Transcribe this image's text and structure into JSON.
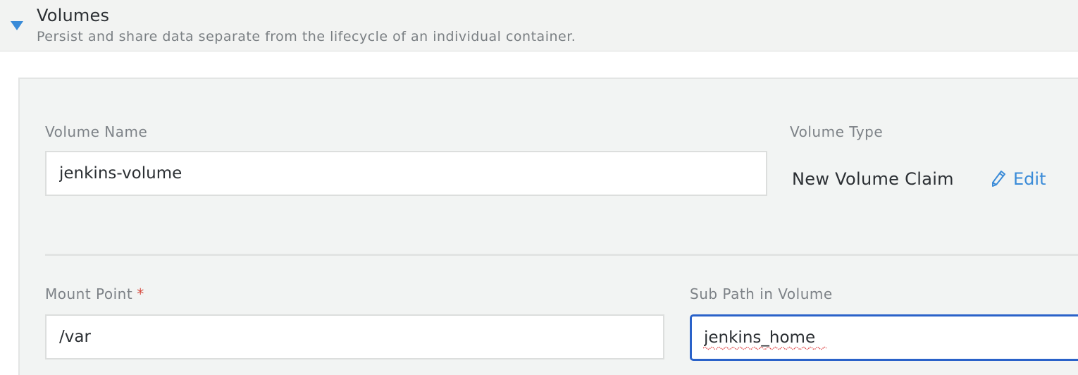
{
  "section": {
    "title": "Volumes",
    "description": "Persist and share data separate from the lifecycle of an individual container.",
    "toggle_icon": "triangle-down-icon",
    "accent_color": "#3a8bd8"
  },
  "volume": {
    "name_label": "Volume Name",
    "name_value": "jenkins-volume",
    "type_label": "Volume Type",
    "type_value": "New Volume Claim",
    "edit_label": "Edit",
    "edit_icon": "pencil-icon",
    "mount_label": "Mount Point",
    "mount_required": "*",
    "mount_value": "/var",
    "subpath_label": "Sub Path in Volume",
    "subpath_value": "jenkins_home"
  }
}
